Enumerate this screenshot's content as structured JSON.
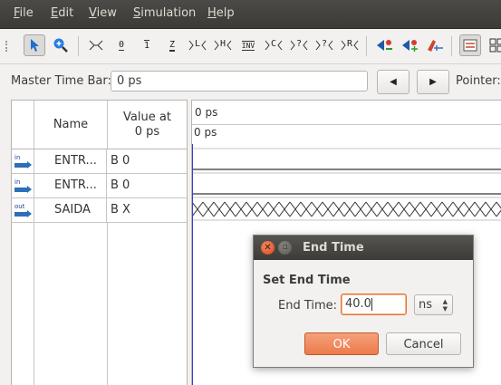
{
  "menubar": {
    "items": [
      {
        "pre": "",
        "u": "F",
        "post": "ile"
      },
      {
        "pre": "",
        "u": "E",
        "post": "dit"
      },
      {
        "pre": "",
        "u": "V",
        "post": "iew"
      },
      {
        "pre": "",
        "u": "S",
        "post": "imulation"
      },
      {
        "pre": "",
        "u": "H",
        "post": "elp"
      }
    ]
  },
  "toolbar": {
    "tools": [
      "pointer-icon",
      "zoom-icon",
      "don't-care-icon",
      "0",
      "1",
      "Z",
      "weak-low",
      "weak-high",
      "INV",
      "count-value",
      "random-value",
      "X?",
      "R",
      "snap-icon",
      "zoom-in-icon",
      "zoom-out-icon",
      "wave-icon",
      "grid-icon"
    ],
    "labels": {
      "zero": "0",
      "one": "1",
      "z": "Z",
      "wl": "L",
      "wh": "H",
      "inv": "INV",
      "c": "C",
      "q": "?",
      "r": "R"
    }
  },
  "master_time_bar": {
    "label": "Master Time Bar:",
    "value": "0 ps"
  },
  "pointer": {
    "label": "Pointer:"
  },
  "signal_table": {
    "header_name": "Name",
    "header_value": "Value at\n0 ps",
    "rows": [
      {
        "icon": "in",
        "name": "ENTR...",
        "value": "B 0"
      },
      {
        "icon": "in",
        "name": "ENTR...",
        "value": "B 0"
      },
      {
        "icon": "out",
        "name": "SAIDA",
        "value": "B X"
      }
    ]
  },
  "waveform": {
    "header_time": "0 ps",
    "cursor_time": "0 ps"
  },
  "dialog": {
    "title": "End Time",
    "section": "Set End Time",
    "field_label": "End Time:",
    "field_value": "40.0",
    "unit": "ns",
    "ok": "OK",
    "cancel": "Cancel",
    "close_glyph": "✕",
    "min_glyph": "▫"
  }
}
